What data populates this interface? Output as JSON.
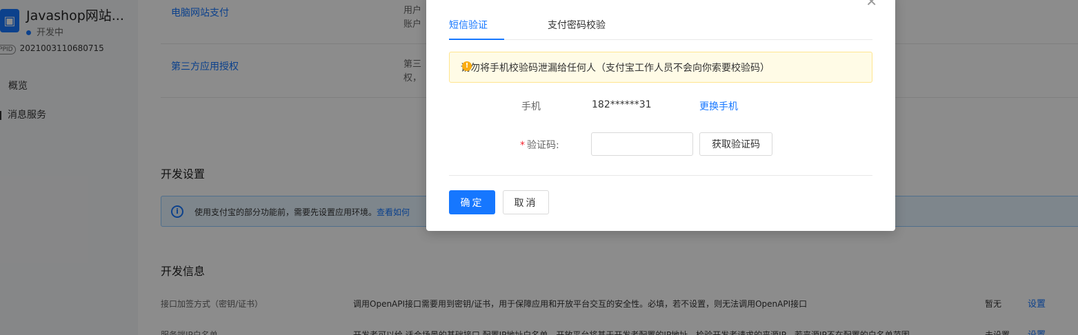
{
  "sidebar": {
    "app_name": "Javashop网站...",
    "status": "开发中",
    "appid_tag": "APPID",
    "appid": "2021003110680715",
    "nav": [
      "概览",
      "消息服务"
    ]
  },
  "content": {
    "rows": [
      {
        "title": "电脑网站支付",
        "desc_line1": "用户",
        "desc_line2": "账户"
      },
      {
        "title": "第三方应用授权",
        "desc_line1": "第三",
        "desc_line2": "权，"
      }
    ],
    "dev_settings_title": "开发设置",
    "info_text": "使用支付宝的部分功能前，需要先设置应用环境。",
    "info_link": "查看如何",
    "dev_info_title": "开发信息",
    "kv_rows": [
      {
        "label": "接口加签方式（密钥/证书）",
        "desc": "调用OpenAPI接口需要用到密钥/证书，用于保障应用和开放平台交互的安全性。必填，若不设置，则无法调用OpenAPI接口",
        "state": "暂无",
        "action": "设置"
      },
      {
        "label": "服务端IP白名单",
        "desc": "开发者可以给 适合场景的基础接口 配置IP地址白名单，开放平台将基于开发者配置的IP地址，检验开发者请求的来源IP，若来源IP不在配置的白名单范围",
        "state": "未设置",
        "action": "设置"
      }
    ]
  },
  "modal": {
    "tabs": [
      "短信验证",
      "支付密码校验"
    ],
    "active_tab": 0,
    "warning": "请勿将手机校验码泄漏给任何人（支付宝工作人员不会向你索要校验码）",
    "phone_label": "手机",
    "phone_value": "182******31",
    "change_phone": "更换手机",
    "code_label": "验证码:",
    "code_value": "",
    "get_code": "获取验证码",
    "ok": "确定",
    "cancel": "取消",
    "close_icon": "close-icon"
  },
  "colors": {
    "accent": "#1677ff",
    "warning_bg": "#fffbe6",
    "info_bg": "#e6f4ff"
  }
}
